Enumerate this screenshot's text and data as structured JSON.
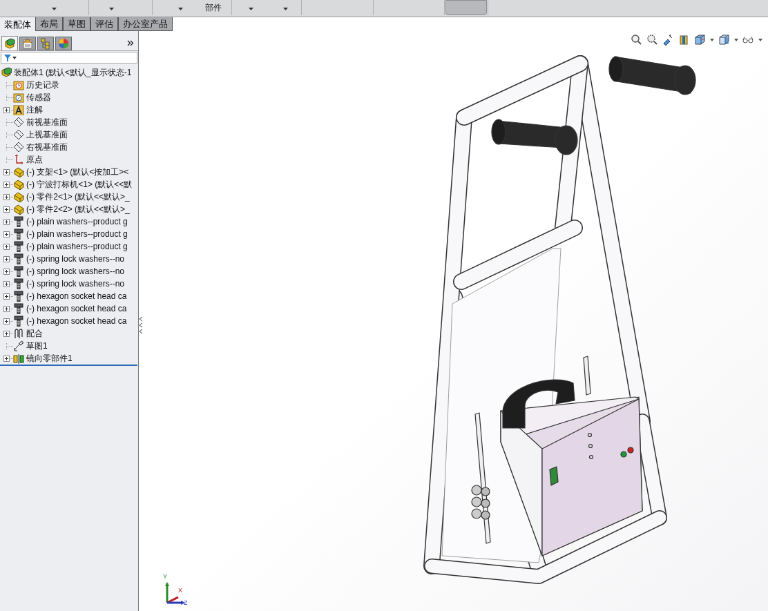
{
  "toolbar": {
    "labels": [
      "部件"
    ]
  },
  "command_tabs": [
    {
      "label": "装配体",
      "selected": true
    },
    {
      "label": "布局",
      "selected": false
    },
    {
      "label": "草图",
      "selected": false
    },
    {
      "label": "评估",
      "selected": false
    },
    {
      "label": "办公室产品",
      "selected": false
    }
  ],
  "panel_tabs": [
    {
      "kind": "feature-tree",
      "selected": true
    },
    {
      "kind": "property",
      "selected": false
    },
    {
      "kind": "config",
      "selected": false
    },
    {
      "kind": "display",
      "selected": false
    }
  ],
  "tree": {
    "root": {
      "label": "装配体1  (默认<默认_显示状态-1",
      "kind": "assembly"
    },
    "items": [
      {
        "label": "历史记录",
        "kind": "history",
        "expandable": false
      },
      {
        "label": "传感器",
        "kind": "sensor",
        "expandable": false
      },
      {
        "label": "注解",
        "kind": "annotation",
        "expandable": true
      },
      {
        "label": "前视基准面",
        "kind": "plane",
        "expandable": false
      },
      {
        "label": "上视基准面",
        "kind": "plane",
        "expandable": false
      },
      {
        "label": "右视基准面",
        "kind": "plane",
        "expandable": false
      },
      {
        "label": "原点",
        "kind": "origin",
        "expandable": false
      },
      {
        "label": "(-) 支架<1> (默认<按加工><",
        "kind": "component",
        "expandable": true
      },
      {
        "label": "(-) 宁波打标机<1> (默认<<默",
        "kind": "component",
        "expandable": true
      },
      {
        "label": "(-) 零件2<1> (默认<<默认>_",
        "kind": "component",
        "expandable": true
      },
      {
        "label": "(-) 零件2<2> (默认<<默认>_",
        "kind": "component",
        "expandable": true
      },
      {
        "label": "(-) plain washers--product g",
        "kind": "fastener",
        "expandable": true
      },
      {
        "label": "(-) plain washers--product g",
        "kind": "fastener",
        "expandable": true
      },
      {
        "label": "(-) plain washers--product g",
        "kind": "fastener",
        "expandable": true
      },
      {
        "label": "(-) spring lock washers--no",
        "kind": "fastener",
        "expandable": true
      },
      {
        "label": "(-) spring lock washers--no",
        "kind": "fastener",
        "expandable": true
      },
      {
        "label": "(-) spring lock washers--no",
        "kind": "fastener",
        "expandable": true
      },
      {
        "label": "(-) hexagon socket head ca",
        "kind": "fastener",
        "expandable": true
      },
      {
        "label": "(-) hexagon socket head ca",
        "kind": "fastener",
        "expandable": true
      },
      {
        "label": "(-) hexagon socket head ca",
        "kind": "fastener",
        "expandable": true
      },
      {
        "label": "配合",
        "kind": "mates",
        "expandable": true
      },
      {
        "label": "草图1",
        "kind": "sketch",
        "expandable": false
      },
      {
        "label": "镜向零部件1",
        "kind": "mirror",
        "expandable": true
      }
    ]
  },
  "triad": {
    "labels": [
      "Y",
      "X",
      "Z"
    ]
  }
}
